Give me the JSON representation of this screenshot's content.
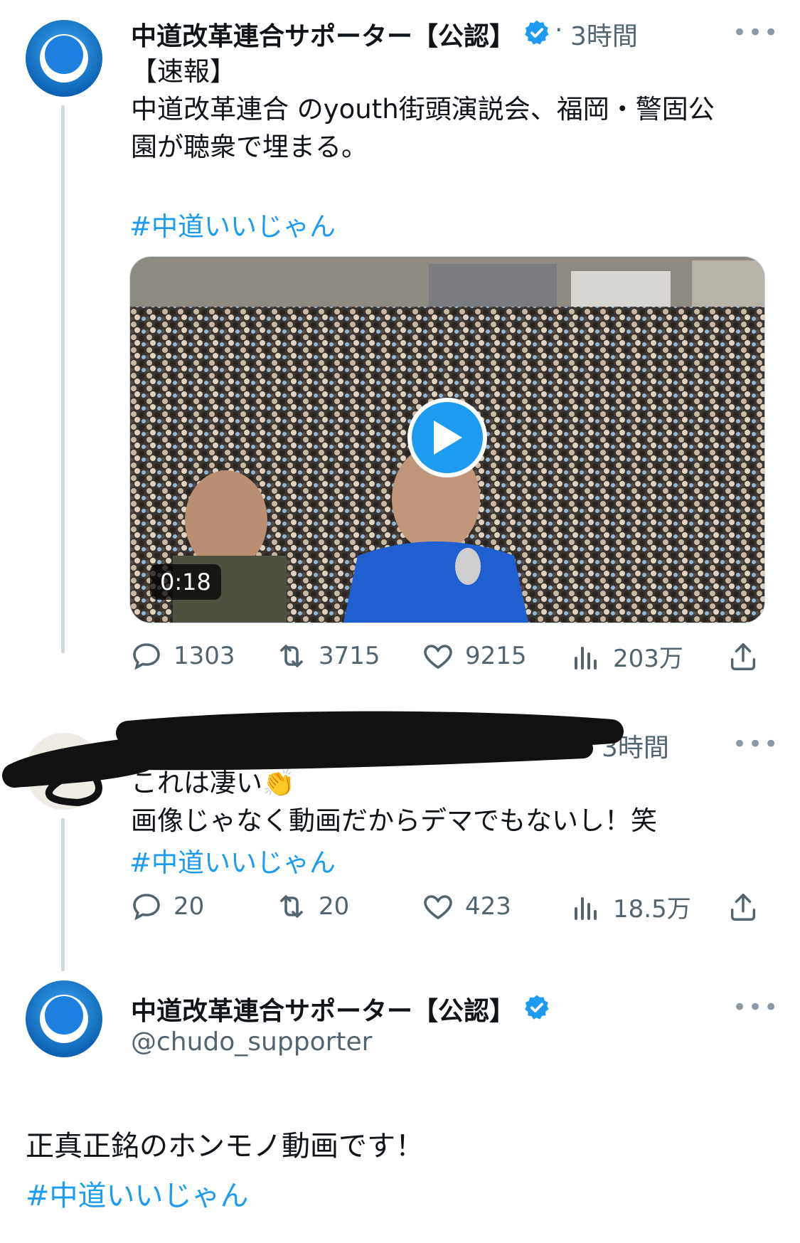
{
  "tweet1": {
    "display_name": "中道改革連合サポーター【公認】",
    "separator": "·",
    "time": "3時間",
    "more_icon": "more-icon",
    "lines": [
      "【速報】",
      "中道改革連合 のyouth街頭演説会、福岡・警固公",
      "園が聴衆で埋まる。"
    ],
    "hashtag": "#中道いいじゃん",
    "video": {
      "duration": "0:18"
    },
    "actions": {
      "replies": "1303",
      "retweets": "3715",
      "likes": "9215",
      "views": "203万"
    }
  },
  "tweet2": {
    "time": "3時間",
    "lines": [
      "これは凄い👏",
      "画像じゃなく動画だからデマでもないし！笑"
    ],
    "hashtag": "#中道いいじゃん",
    "actions": {
      "replies": "20",
      "retweets": "20",
      "likes": "423",
      "views": "18.5万"
    }
  },
  "tweet3": {
    "display_name": "中道改革連合サポーター【公認】",
    "handle": "@chudo_supporter",
    "text": "正真正銘のホンモノ動画です！",
    "hashtag": "#中道いいじゃん"
  },
  "colors": {
    "accent": "#1d9bf0",
    "text": "#0f1419",
    "muted": "#536471",
    "line": "#cfd9de"
  }
}
